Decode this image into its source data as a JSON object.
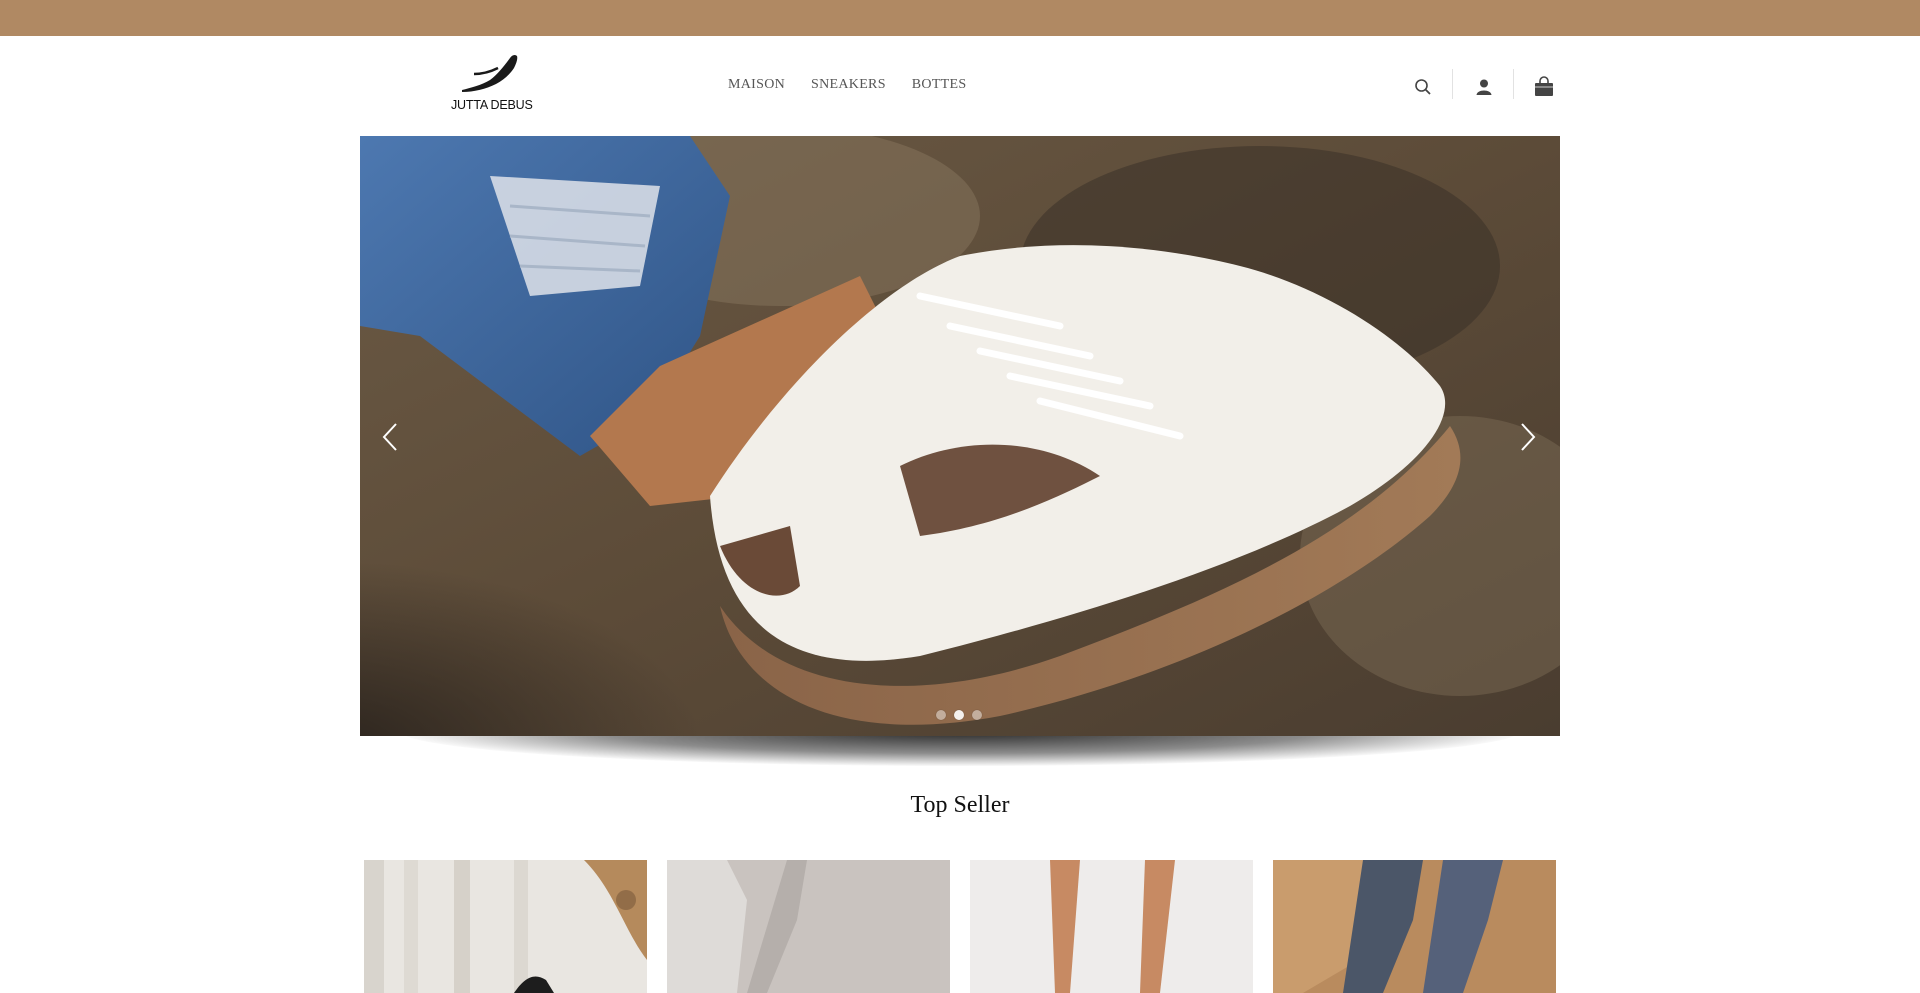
{
  "brand": {
    "name": "JUTTA DEBUS",
    "logo_icon": "sneaker-logo-icon"
  },
  "nav": {
    "items": [
      {
        "label": "MAISON"
      },
      {
        "label": "SNEAKERS"
      },
      {
        "label": "BOTTES"
      }
    ]
  },
  "header_icons": [
    "search-icon",
    "account-icon",
    "shopping-bag-icon"
  ],
  "hero": {
    "slide_count": 3,
    "active_slide": 2,
    "prev_icon": "chevron-left-icon",
    "next_icon": "chevron-right-icon"
  },
  "section": {
    "title": "Top Seller"
  },
  "colors": {
    "topbar": "#b08963",
    "nav_text": "#555555",
    "title": "#111111"
  }
}
